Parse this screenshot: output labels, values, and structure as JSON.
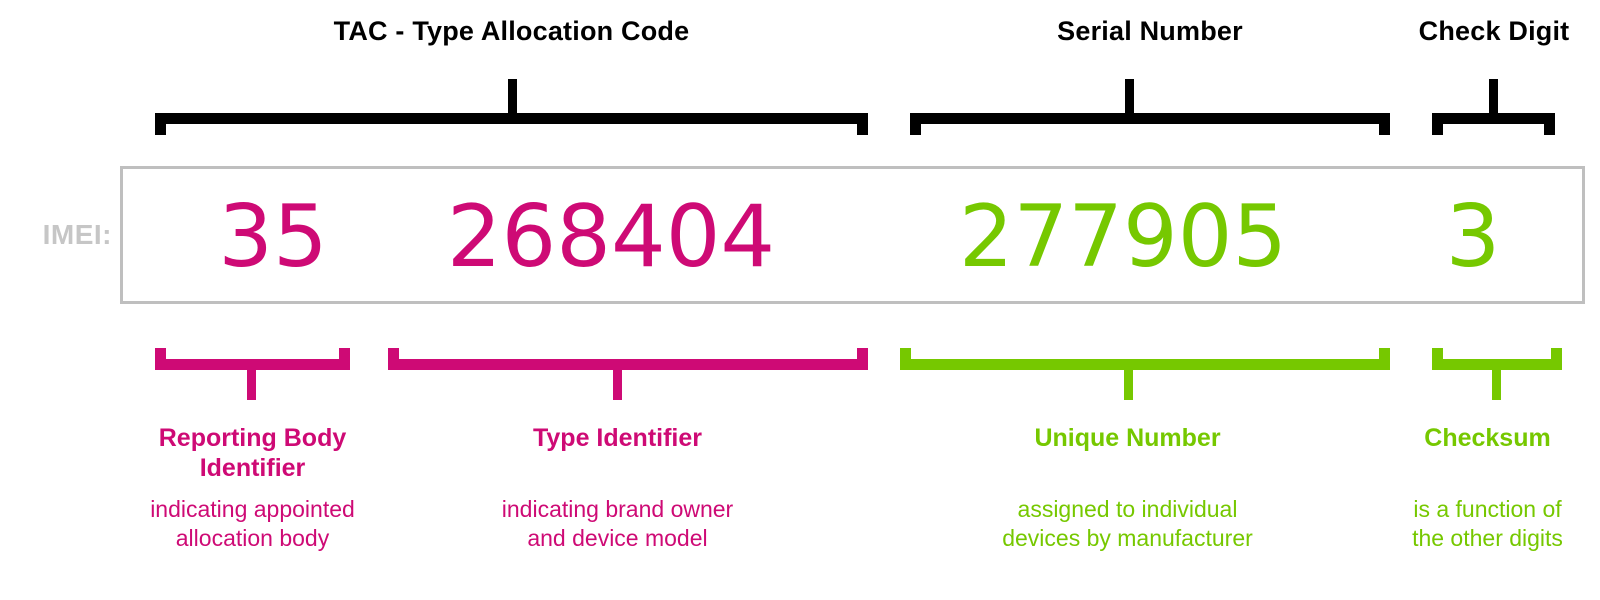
{
  "palette": {
    "black": "#000000",
    "magenta": "#CE0A75",
    "green": "#76C800",
    "gray_border": "#bfbfbf",
    "gray_label": "#c6c6c6",
    "background": "#ffffff"
  },
  "imei": {
    "row_label": "IMEI:",
    "full_number": "35268404277905 3",
    "groups": [
      {
        "id": "reporting-body",
        "digits": "35",
        "color": "#CE0A75"
      },
      {
        "id": "type-identifier",
        "digits": "268404",
        "color": "#CE0A75"
      },
      {
        "id": "unique-number",
        "digits": "277905",
        "color": "#76C800"
      },
      {
        "id": "check-digit",
        "digits": "3",
        "color": "#76C800"
      }
    ]
  },
  "top_sections": [
    {
      "id": "tac",
      "label": "TAC - Type Allocation Code",
      "color": "#000000"
    },
    {
      "id": "serial-number",
      "label": "Serial Number",
      "color": "#000000"
    },
    {
      "id": "check-digit",
      "label": "Check Digit",
      "color": "#000000"
    }
  ],
  "bottom_sections": [
    {
      "id": "reporting-body-identifier",
      "title": "Reporting Body\nIdentifier",
      "description": "indicating appointed\nallocation body",
      "color": "#CE0A75"
    },
    {
      "id": "type-identifier",
      "title": "Type Identifier",
      "description": "indicating brand owner\nand device model",
      "color": "#CE0A75"
    },
    {
      "id": "unique-number",
      "title": "Unique Number",
      "description": "assigned to individual\ndevices by manufacturer",
      "color": "#76C800"
    },
    {
      "id": "checksum",
      "title": "Checksum",
      "description": "is a function of\nthe other digits",
      "color": "#76C800"
    }
  ]
}
